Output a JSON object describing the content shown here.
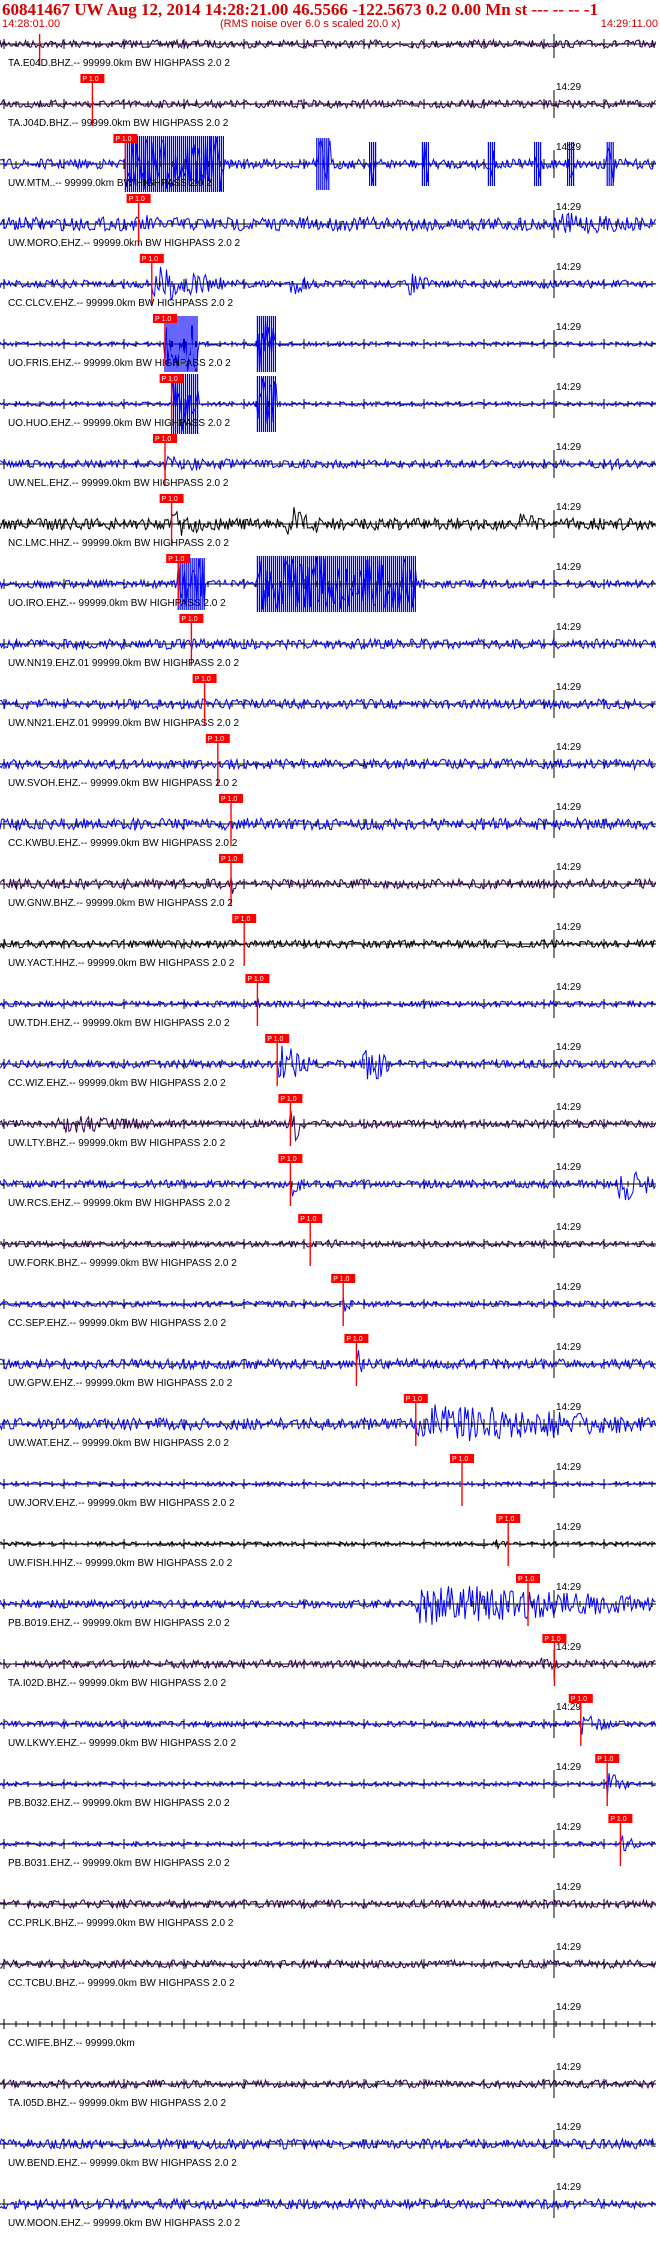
{
  "header": {
    "title": "60841467 UW Aug 12, 2014 14:28:21.00   46.5566 -122.5673  0.2 0.00 Mn st --- -- --  -1",
    "time_left": "14:28:01.00",
    "subtitle": "(RMS noise over 6.0 s scaled 20.0 x)",
    "time_right": "14:29:11.00"
  },
  "tick_label": "14:29",
  "pick_label": "P 1.0",
  "colors": {
    "blue": "#0000ff",
    "black": "#000000",
    "dark": "#330055",
    "pick": "#ff0000",
    "red": "#d40000"
  },
  "traces": [
    {
      "label": "TA.E04D.BHZ.-- 99999.0km BW  HIGHPASS  2.0  2",
      "color": "dark",
      "amp": 4,
      "pick": 0.06,
      "bursts": []
    },
    {
      "label": "TA.J04D.BHZ.-- 99999.0km BW  HIGHPASS  2.0  2",
      "color": "dark",
      "amp": 4,
      "pick": 0.14,
      "bursts": []
    },
    {
      "label": "UW.MTM..-- 99999.0km BW  HIGHPASS  2.0  2",
      "color": "blue",
      "amp": 5,
      "pick": 0.19,
      "bursts": [
        [
          0.19,
          0.34,
          28,
          "block"
        ],
        [
          0.48,
          0.5,
          26,
          "block"
        ],
        [
          0.56,
          0.57,
          22,
          "block"
        ],
        [
          0.64,
          0.65,
          22,
          "block"
        ],
        [
          0.74,
          0.75,
          22,
          "block"
        ],
        [
          0.81,
          0.82,
          22,
          "block"
        ],
        [
          0.86,
          0.87,
          22,
          "block"
        ],
        [
          0.92,
          0.93,
          22,
          "block"
        ]
      ]
    },
    {
      "label": "UW.MORO.EHZ.-- 99999.0km BW  HIGHPASS  2.0  2",
      "color": "blue",
      "amp": 7,
      "pick": 0.21,
      "bursts": [
        [
          0.21,
          0.24,
          14,
          "burst"
        ],
        [
          0.85,
          1.0,
          12,
          "burst"
        ]
      ]
    },
    {
      "label": "CC.CLCV.EHZ.-- 99999.0km BW  HIGHPASS  2.0  2",
      "color": "blue",
      "amp": 4,
      "pick": 0.23,
      "bursts": [
        [
          0.23,
          0.34,
          20,
          "burst"
        ],
        [
          0.44,
          0.48,
          12,
          "burst"
        ],
        [
          0.62,
          0.66,
          12,
          "burst"
        ]
      ]
    },
    {
      "label": "UO.FRIS.EHZ.-- 99999.0km BW  HIGHPASS  2.0  2",
      "color": "blue",
      "amp": 2,
      "pick": 0.25,
      "bursts": [
        [
          0.25,
          0.3,
          28,
          "block"
        ],
        [
          0.39,
          0.42,
          28,
          "block"
        ]
      ]
    },
    {
      "label": "UO.HUO.EHZ.-- 99999.0km BW  HIGHPASS  2.0  2",
      "color": "blue",
      "amp": 2,
      "pick": 0.26,
      "bursts": [
        [
          0.26,
          0.3,
          30,
          "block"
        ],
        [
          0.39,
          0.42,
          28,
          "block"
        ]
      ]
    },
    {
      "label": "UW.NEL.EHZ.-- 99999.0km BW  HIGHPASS  2.0  2",
      "color": "blue",
      "amp": 4,
      "pick": 0.25,
      "bursts": [
        [
          0.25,
          0.44,
          8,
          "burst"
        ],
        [
          0.92,
          1.0,
          6,
          "burst"
        ]
      ]
    },
    {
      "label": "NC.LMC.HHZ.-- 99999.0km BW  HIGHPASS  2.0  2",
      "color": "black",
      "amp": 6,
      "pick": 0.26,
      "bursts": [
        [
          0.26,
          0.32,
          16,
          "burst"
        ],
        [
          0.43,
          0.5,
          20,
          "burst"
        ],
        [
          0.78,
          0.84,
          12,
          "burst"
        ]
      ]
    },
    {
      "label": "UO.IRO.EHZ.-- 99999.0km BW  HIGHPASS  2.0  2",
      "color": "blue",
      "amp": 4,
      "pick": 0.27,
      "bursts": [
        [
          0.27,
          0.31,
          26,
          "block"
        ],
        [
          0.39,
          0.63,
          28,
          "block"
        ]
      ]
    },
    {
      "label": "UW.NN19.EHZ.01 99999.0km BW  HIGHPASS  2.0  2",
      "color": "blue",
      "amp": 5,
      "pick": 0.29,
      "bursts": []
    },
    {
      "label": "UW.NN21.EHZ.01 99999.0km BW  HIGHPASS  2.0  2",
      "color": "blue",
      "amp": 5,
      "pick": 0.31,
      "bursts": []
    },
    {
      "label": "UW.SVOH.EHZ.-- 99999.0km BW  HIGHPASS  2.0  2",
      "color": "blue",
      "amp": 5,
      "pick": 0.33,
      "bursts": []
    },
    {
      "label": "CC.KWBU.EHZ.-- 99999.0km BW  HIGHPASS  2.0  2",
      "color": "blue",
      "amp": 6,
      "pick": 0.35,
      "bursts": [
        [
          0.35,
          0.37,
          10,
          "burst"
        ]
      ]
    },
    {
      "label": "UW.GNW.BHZ.-- 99999.0km BW  HIGHPASS  2.0  2",
      "color": "dark",
      "amp": 5,
      "pick": 0.35,
      "bursts": [
        [
          0.35,
          0.36,
          12,
          "burst"
        ]
      ]
    },
    {
      "label": "UW.YACT.HHZ.-- 99999.0km BW  HIGHPASS  2.0  2",
      "color": "black",
      "amp": 4,
      "pick": 0.37,
      "bursts": []
    },
    {
      "label": "UW.TDH.EHZ.-- 99999.0km BW  HIGHPASS  2.0  2",
      "color": "blue",
      "amp": 3,
      "pick": 0.39,
      "bursts": [
        [
          0.39,
          0.4,
          8,
          "burst"
        ]
      ]
    },
    {
      "label": "CC.WIZ.EHZ.-- 99999.0km BW  HIGHPASS  2.0  2",
      "color": "blue",
      "amp": 4,
      "pick": 0.42,
      "bursts": [
        [
          0.42,
          0.47,
          22,
          "burst"
        ],
        [
          0.55,
          0.6,
          22,
          "burst"
        ]
      ]
    },
    {
      "label": "UW.LTY.BHZ.-- 99999.0km BW  HIGHPASS  2.0  2",
      "color": "dark",
      "amp": 4,
      "pick": 0.44,
      "bursts": [
        [
          0.08,
          0.28,
          10,
          "burst"
        ],
        [
          0.44,
          0.46,
          26,
          "burst"
        ]
      ]
    },
    {
      "label": "UW.RCS.EHZ.-- 99999.0km BW  HIGHPASS  2.0  2",
      "color": "blue",
      "amp": 4,
      "pick": 0.44,
      "bursts": [
        [
          0.44,
          0.46,
          14,
          "burst"
        ],
        [
          0.93,
          1.0,
          20,
          "burst"
        ]
      ]
    },
    {
      "label": "UW.FORK.BHZ.-- 99999.0km BW  HIGHPASS  2.0  2",
      "color": "dark",
      "amp": 3,
      "pick": 0.47,
      "bursts": [
        [
          0.49,
          0.52,
          8,
          "burst"
        ]
      ]
    },
    {
      "label": "CC.SEP.EHZ.-- 99999.0km BW  HIGHPASS  2.0  2",
      "color": "blue",
      "amp": 3,
      "pick": 0.52,
      "bursts": [
        [
          0.52,
          0.54,
          10,
          "burst"
        ]
      ]
    },
    {
      "label": "UW.GPW.EHZ.-- 99999.0km BW  HIGHPASS  2.0  2",
      "color": "blue",
      "amp": 5,
      "pick": 0.54,
      "bursts": [
        [
          0.54,
          0.56,
          16,
          "burst"
        ]
      ]
    },
    {
      "label": "UW.WAT.EHZ.-- 99999.0km BW  HIGHPASS  2.0  2",
      "color": "blue",
      "amp": 6,
      "pick": 0.63,
      "bursts": [
        [
          0.63,
          1.0,
          22,
          "burst"
        ]
      ]
    },
    {
      "label": "UW.JORV.EHZ.-- 99999.0km BW  HIGHPASS  2.0  2",
      "color": "blue",
      "amp": 2,
      "pick": 0.7,
      "bursts": []
    },
    {
      "label": "UW.FISH.HHZ.-- 99999.0km BW  HIGHPASS  2.0  2",
      "color": "black",
      "amp": 2,
      "pick": 0.77,
      "bursts": [
        [
          0.75,
          0.77,
          6,
          "burst"
        ]
      ]
    },
    {
      "label": "PB.B019.EHZ.-- 99999.0km BW  HIGHPASS  2.0  2",
      "color": "blue",
      "amp": 4,
      "pick": 0.8,
      "bursts": [
        [
          0.63,
          1.0,
          22,
          "burst"
        ]
      ]
    },
    {
      "label": "TA.I02D.BHZ.-- 99999.0km BW  HIGHPASS  2.0  2",
      "color": "dark",
      "amp": 4,
      "pick": 0.84,
      "bursts": [
        [
          0.82,
          0.86,
          10,
          "burst"
        ]
      ]
    },
    {
      "label": "UW.LKWY.EHZ.-- 99999.0km BW  HIGHPASS  2.0  2",
      "color": "blue",
      "amp": 3,
      "pick": 0.88,
      "bursts": [
        [
          0.88,
          0.93,
          12,
          "burst"
        ]
      ]
    },
    {
      "label": "PB.B032.EHZ.-- 99999.0km BW  HIGHPASS  2.0  2",
      "color": "blue",
      "amp": 2,
      "pick": 0.92,
      "bursts": [
        [
          0.92,
          0.96,
          12,
          "burst"
        ]
      ]
    },
    {
      "label": "PB.B031.EHZ.-- 99999.0km BW  HIGHPASS  2.0  2",
      "color": "blue",
      "amp": 2,
      "pick": 0.94,
      "bursts": [
        [
          0.94,
          0.97,
          10,
          "burst"
        ]
      ]
    },
    {
      "label": "CC.PRLK.BHZ.-- 99999.0km BW  HIGHPASS  2.0  2",
      "color": "dark",
      "amp": 4,
      "pick": null,
      "bursts": []
    },
    {
      "label": "CC.TCBU.BHZ.-- 99999.0km BW  HIGHPASS  2.0  2",
      "color": "dark",
      "amp": 4,
      "pick": null,
      "bursts": []
    },
    {
      "label": "CC.WIFE.BHZ.-- 99999.0km",
      "color": "black",
      "amp": 0,
      "pick": null,
      "bursts": []
    },
    {
      "label": "TA.I05D.BHZ.-- 99999.0km BW  HIGHPASS  2.0  2",
      "color": "dark",
      "amp": 4,
      "pick": null,
      "bursts": []
    },
    {
      "label": "UW.BEND.EHZ.-- 99999.0km BW  HIGHPASS  2.0  2",
      "color": "blue",
      "amp": 5,
      "pick": null,
      "bursts": []
    },
    {
      "label": "UW.MOON.EHZ.-- 99999.0km BW  HIGHPASS  2.0  2",
      "color": "blue",
      "amp": 5,
      "pick": null,
      "bursts": []
    }
  ]
}
